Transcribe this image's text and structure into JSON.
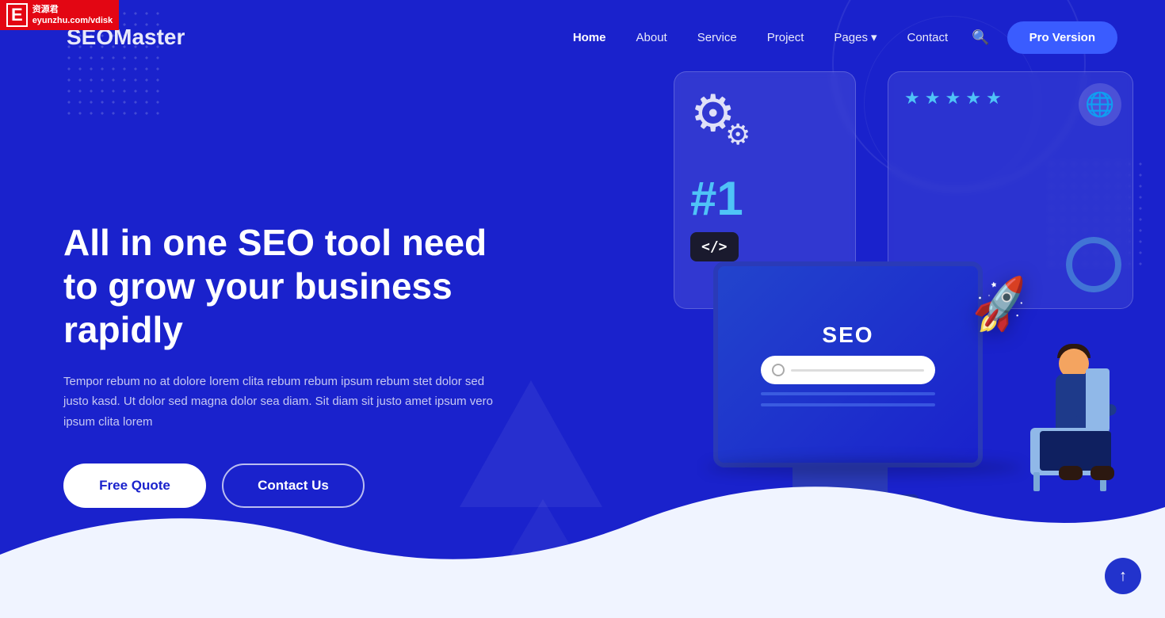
{
  "logo": {
    "text_seo": "SEO",
    "text_master": "Master",
    "watermark_line1": "资源君",
    "watermark_line2": "eyunzhu.com/vdisk"
  },
  "nav": {
    "home": "Home",
    "about": "About",
    "service": "Service",
    "project": "Project",
    "pages": "Pages",
    "contact": "Contact",
    "pro_version": "Pro Version"
  },
  "hero": {
    "title": "All in one SEO tool need to grow your business rapidly",
    "description": "Tempor rebum no at dolore lorem clita rebum rebum ipsum rebum stet dolor sed justo kasd. Ut dolor sed magna dolor sea diam. Sit diam sit justo amet ipsum vero ipsum clita lorem",
    "btn_free_quote": "Free Quote",
    "btn_contact_us": "Contact Us"
  },
  "illustration": {
    "rank": "#1",
    "seo_label": "SEO",
    "code_badge": "</>",
    "stars": [
      "★",
      "★",
      "★",
      "★",
      "★"
    ],
    "globe": "🌐",
    "rocket": "🚀"
  },
  "back_to_top": "↑",
  "colors": {
    "hero_bg": "#1a22cc",
    "accent_blue": "#4fc3f7",
    "nav_pro_bg": "#3a5cff",
    "btn_white": "#ffffff"
  }
}
